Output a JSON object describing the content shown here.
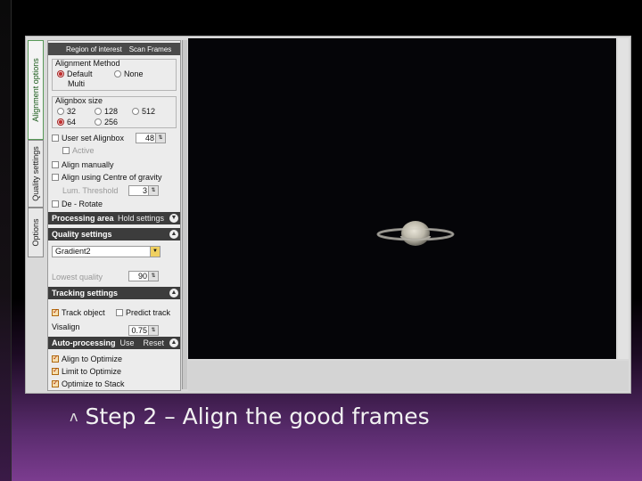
{
  "vertical_tabs": [
    "Options",
    "Quality settings",
    "Alignment options"
  ],
  "panel": {
    "top_tabs": [
      "Region of interest",
      "Scan Frames"
    ],
    "alignment_method": {
      "label": "Alignment Method",
      "options": [
        "Default",
        "None",
        "Multi"
      ],
      "selected": "Default"
    },
    "alignbox_size": {
      "label": "Alignbox size",
      "options": [
        "32",
        "128",
        "512",
        "64",
        "256"
      ],
      "selected": "64"
    },
    "user_set_alignbox": {
      "label": "User set Alignbox",
      "value": "48"
    },
    "active": {
      "label": "Active"
    },
    "align_manually": {
      "label": "Align manually"
    },
    "align_cog": {
      "label": "Align using Centre of gravity"
    },
    "lum_threshold": {
      "label": "Lum. Threshold",
      "value": "3"
    },
    "de_rotate": {
      "label": "De - Rotate"
    },
    "processing_area": {
      "label": "Processing area",
      "right": "Hold settings"
    },
    "quality_settings": {
      "label": "Quality settings"
    },
    "gradient_combo": {
      "value": "Gradient2"
    },
    "lowest_quality": {
      "label": "Lowest quality",
      "value": "90"
    },
    "tracking_settings": {
      "label": "Tracking settings"
    },
    "track_object": {
      "label": "Track object"
    },
    "predict_track": {
      "label": "Predict track"
    },
    "visalign": {
      "label": "Visalign",
      "value": "0.75"
    },
    "auto_processing": {
      "label": "Auto-processing",
      "use": "Use",
      "reset": "Reset"
    },
    "align_to_optimize": {
      "label": "Align to Optimize"
    },
    "limit_to_optimize": {
      "label": "Limit to Optimize"
    },
    "optimize_to_stack": {
      "label": "Optimize to Stack"
    }
  },
  "caption": {
    "bullet": "ʌ",
    "text": "Step 2 – Align the good frames"
  }
}
